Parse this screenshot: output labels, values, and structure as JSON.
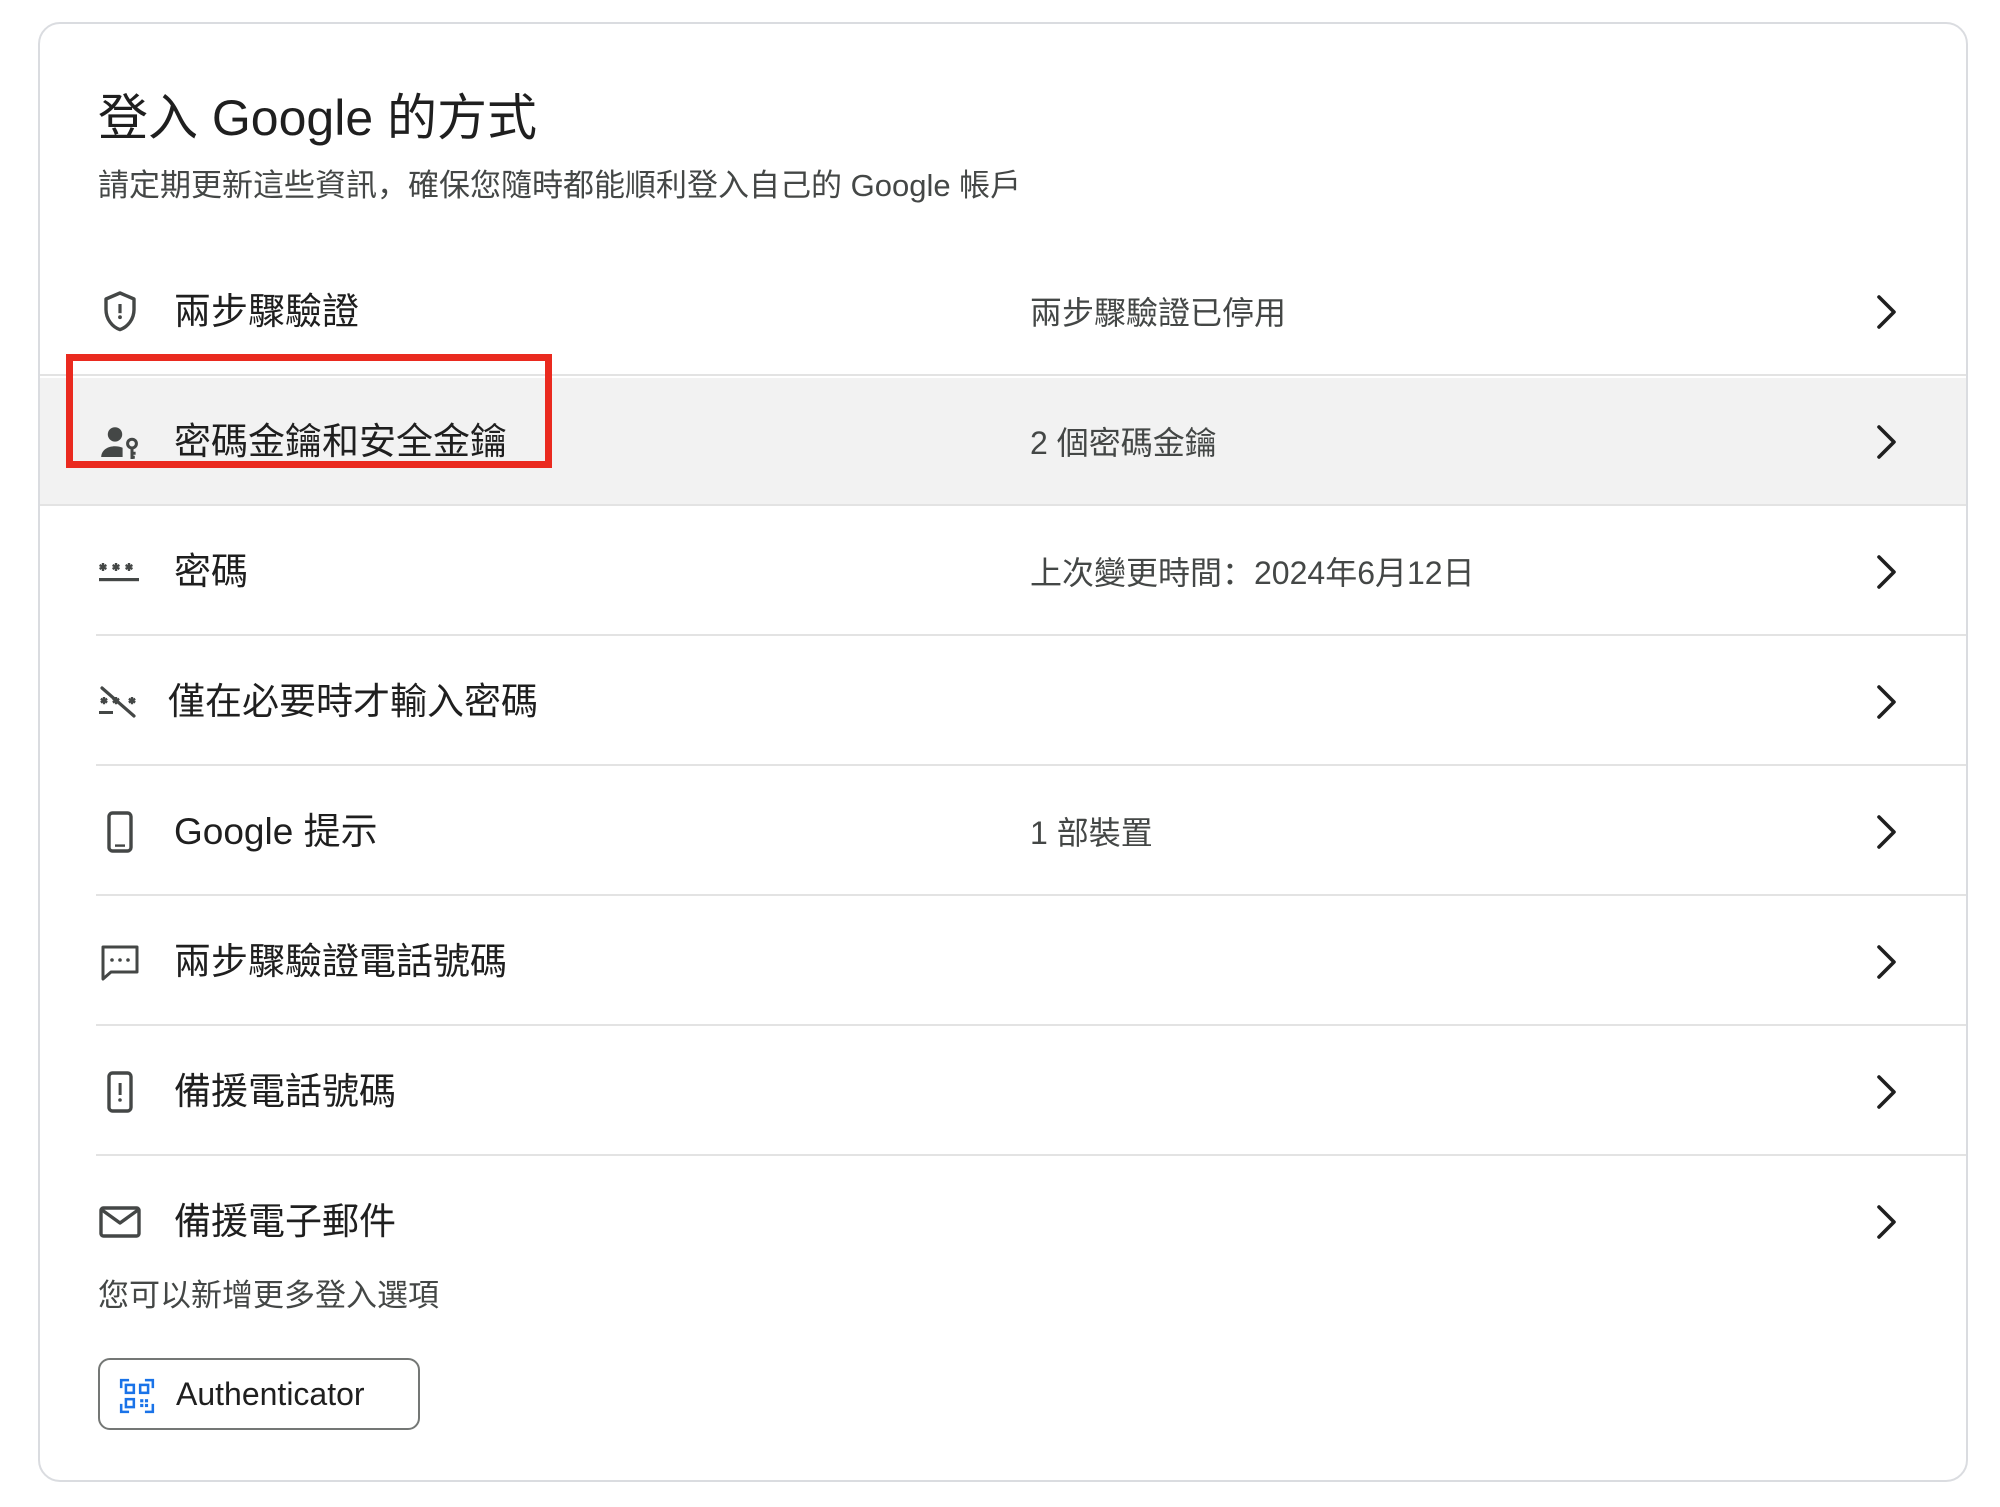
{
  "section": {
    "title": "登入 Google 的方式",
    "subtitle": "請定期更新這些資訊，確保您隨時都能順利登入自己的 Google 帳戶"
  },
  "rows": [
    {
      "label": "兩步驟驗證",
      "value": "兩步驟驗證已停用",
      "icon": "shield-icon"
    },
    {
      "label": "密碼金鑰和安全金鑰",
      "value": "2 個密碼金鑰",
      "icon": "passkey-person-icon",
      "highlighted": true
    },
    {
      "label": "密碼",
      "value": "上次變更時間：2024年6月12日",
      "icon": "password-asterisks-icon"
    },
    {
      "label": "僅在必要時才輸入密碼",
      "value": "",
      "icon": "password-off-icon"
    },
    {
      "label": "Google 提示",
      "value": "1 部裝置",
      "icon": "phone-icon"
    },
    {
      "label": "兩步驟驗證電話號碼",
      "value": "",
      "icon": "message-icon"
    },
    {
      "label": "備援電話號碼",
      "value": "",
      "icon": "phone-alert-icon"
    },
    {
      "label": "備援電子郵件",
      "value": "",
      "icon": "mail-icon"
    }
  ],
  "more_options": {
    "text": "您可以新增更多登入選項",
    "authenticator_label": "Authenticator",
    "authenticator_icon": "qr-code-icon"
  },
  "colors": {
    "highlight_row_bg": "#f2f2f2",
    "annotation_box": "#ea2a1f",
    "authenticator_icon": "#1a73e8"
  }
}
